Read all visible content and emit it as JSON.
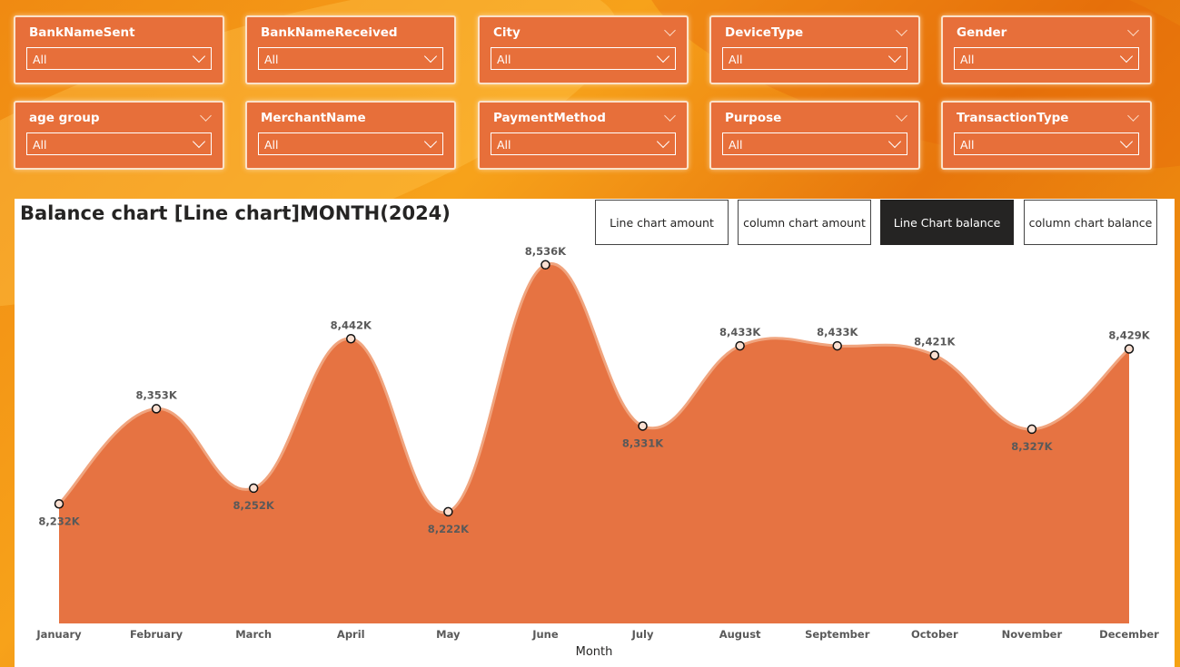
{
  "slicers": [
    {
      "title": "BankNameSent",
      "value": "All",
      "show_header_chevron": false
    },
    {
      "title": "BankNameReceived",
      "value": "All",
      "show_header_chevron": false
    },
    {
      "title": "City",
      "value": "All",
      "show_header_chevron": true
    },
    {
      "title": "DeviceType",
      "value": "All",
      "show_header_chevron": true
    },
    {
      "title": "Gender",
      "value": "All",
      "show_header_chevron": true
    },
    {
      "title": "age group",
      "value": "All",
      "show_header_chevron": true
    },
    {
      "title": "MerchantName",
      "value": "All",
      "show_header_chevron": false
    },
    {
      "title": "PaymentMethod",
      "value": "All",
      "show_header_chevron": true
    },
    {
      "title": "Purpose",
      "value": "All",
      "show_header_chevron": true
    },
    {
      "title": "TransactionType",
      "value": "All",
      "show_header_chevron": true
    }
  ],
  "toggles": [
    {
      "label": "Line chart amount",
      "active": false
    },
    {
      "label": "column chart amount",
      "active": false
    },
    {
      "label": "Line Chart balance",
      "active": true
    },
    {
      "label": "column chart balance",
      "active": false
    }
  ],
  "colors": {
    "area_fill": "#e67342",
    "line": "#f0a47e",
    "slicer_bg": "#e76f3a",
    "active_button": "#252423"
  },
  "chart_data": {
    "type": "area",
    "title": "Balance chart [Line chart]MONTH(2024)",
    "xlabel": "Month",
    "ylabel": "",
    "categories": [
      "January",
      "February",
      "March",
      "April",
      "May",
      "June",
      "July",
      "August",
      "September",
      "October",
      "November",
      "December"
    ],
    "values": [
      8232,
      8353,
      8252,
      8442,
      8222,
      8536,
      8331,
      8433,
      8433,
      8421,
      8327,
      8429
    ],
    "data_labels": [
      "8,232K",
      "8,353K",
      "8,252K",
      "8,442K",
      "8,222K",
      "8,536K",
      "8,331K",
      "8,433K",
      "8,433K",
      "8,421K",
      "8,327K",
      "8,429K"
    ],
    "unit": "K",
    "ylim": [
      8080,
      8545
    ],
    "grid": false,
    "legend": "none"
  }
}
